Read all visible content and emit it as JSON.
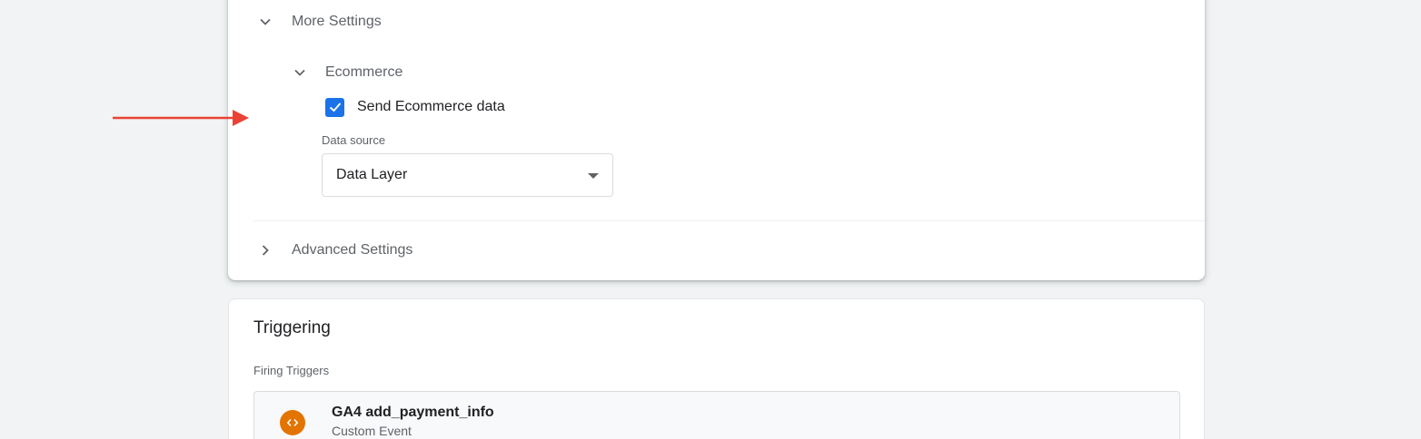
{
  "more_settings": {
    "label": "More Settings",
    "ecommerce": {
      "label": "Ecommerce",
      "send_checkbox": {
        "label": "Send Ecommerce data",
        "checked": true
      },
      "data_source": {
        "label": "Data source",
        "value": "Data Layer"
      }
    }
  },
  "advanced_settings": {
    "label": "Advanced Settings"
  },
  "triggering": {
    "title": "Triggering",
    "firing_label": "Firing Triggers",
    "triggers": [
      {
        "name": "GA4 add_payment_info",
        "type": "Custom Event",
        "icon": "code-icon"
      }
    ]
  },
  "colors": {
    "accent": "#1a73e8",
    "annotation_arrow": "#ea4335",
    "trigger_icon_bg": "#e37400"
  }
}
